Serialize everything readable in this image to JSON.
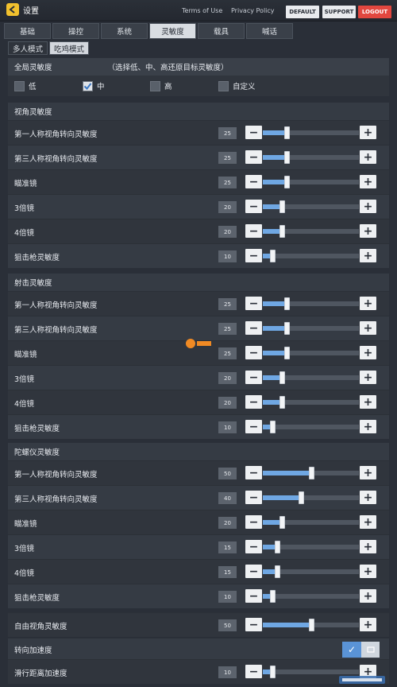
{
  "header": {
    "title": "设置",
    "links": [
      "Terms of Use",
      "Privacy Policy"
    ],
    "buttons": {
      "default": "DEFAULT",
      "support": "SUPPORT",
      "logout": "LOGOUT"
    }
  },
  "tabs": [
    "基础",
    "操控",
    "系统",
    "灵敏度",
    "载具",
    "喊话"
  ],
  "active_tab": "灵敏度",
  "modes": [
    "多人模式",
    "吃鸡模式"
  ],
  "active_mode": "吃鸡模式",
  "global": {
    "title": "全局灵敏度",
    "hint": "（选择低、中、高还原目标灵敏度）",
    "options": [
      {
        "label": "低",
        "checked": false
      },
      {
        "label": "中",
        "checked": true
      },
      {
        "label": "高",
        "checked": false
      },
      {
        "label": "自定义",
        "checked": false
      }
    ]
  },
  "sections": [
    {
      "title": "视角灵敏度",
      "rows": [
        {
          "label": "第一人称视角转向灵敏度",
          "value": "25",
          "level": 0.25
        },
        {
          "label": "第三人称视角转向灵敏度",
          "value": "25",
          "level": 0.25
        },
        {
          "label": "瞄准镜",
          "value": "25",
          "level": 0.25
        },
        {
          "label": "3倍镜",
          "value": "20",
          "level": 0.2
        },
        {
          "label": "4倍镜",
          "value": "20",
          "level": 0.2
        },
        {
          "label": "狙击枪灵敏度",
          "value": "10",
          "level": 0.1
        }
      ]
    },
    {
      "title": "射击灵敏度",
      "rows": [
        {
          "label": "第一人称视角转向灵敏度",
          "value": "25",
          "level": 0.25
        },
        {
          "label": "第三人称视角转向灵敏度",
          "value": "25",
          "level": 0.25
        },
        {
          "label": "瞄准镜",
          "value": "25",
          "level": 0.25
        },
        {
          "label": "3倍镜",
          "value": "20",
          "level": 0.2
        },
        {
          "label": "4倍镜",
          "value": "20",
          "level": 0.2
        },
        {
          "label": "狙击枪灵敏度",
          "value": "10",
          "level": 0.1
        }
      ]
    },
    {
      "title": "陀螺仪灵敏度",
      "rows": [
        {
          "label": "第一人称视角转向灵敏度",
          "value": "50",
          "level": 0.5
        },
        {
          "label": "第三人称视角转向灵敏度",
          "value": "40",
          "level": 0.4
        },
        {
          "label": "瞄准镜",
          "value": "20",
          "level": 0.2
        },
        {
          "label": "3倍镜",
          "value": "15",
          "level": 0.15
        },
        {
          "label": "4倍镜",
          "value": "15",
          "level": 0.15
        },
        {
          "label": "狙击枪灵敏度",
          "value": "10",
          "level": 0.1
        }
      ]
    }
  ],
  "free_look": {
    "label": "自由视角灵敏度",
    "value": "50",
    "level": 0.5
  },
  "turn_accel": {
    "label": "转向加速度",
    "enabled": true
  },
  "slide_accel": {
    "label": "滑行距离加速度",
    "value": "10",
    "level": 0.1
  },
  "colors": {
    "accent": "#6fa7e3",
    "logout": "#e2473f",
    "back_icon": "#f2c12e"
  }
}
